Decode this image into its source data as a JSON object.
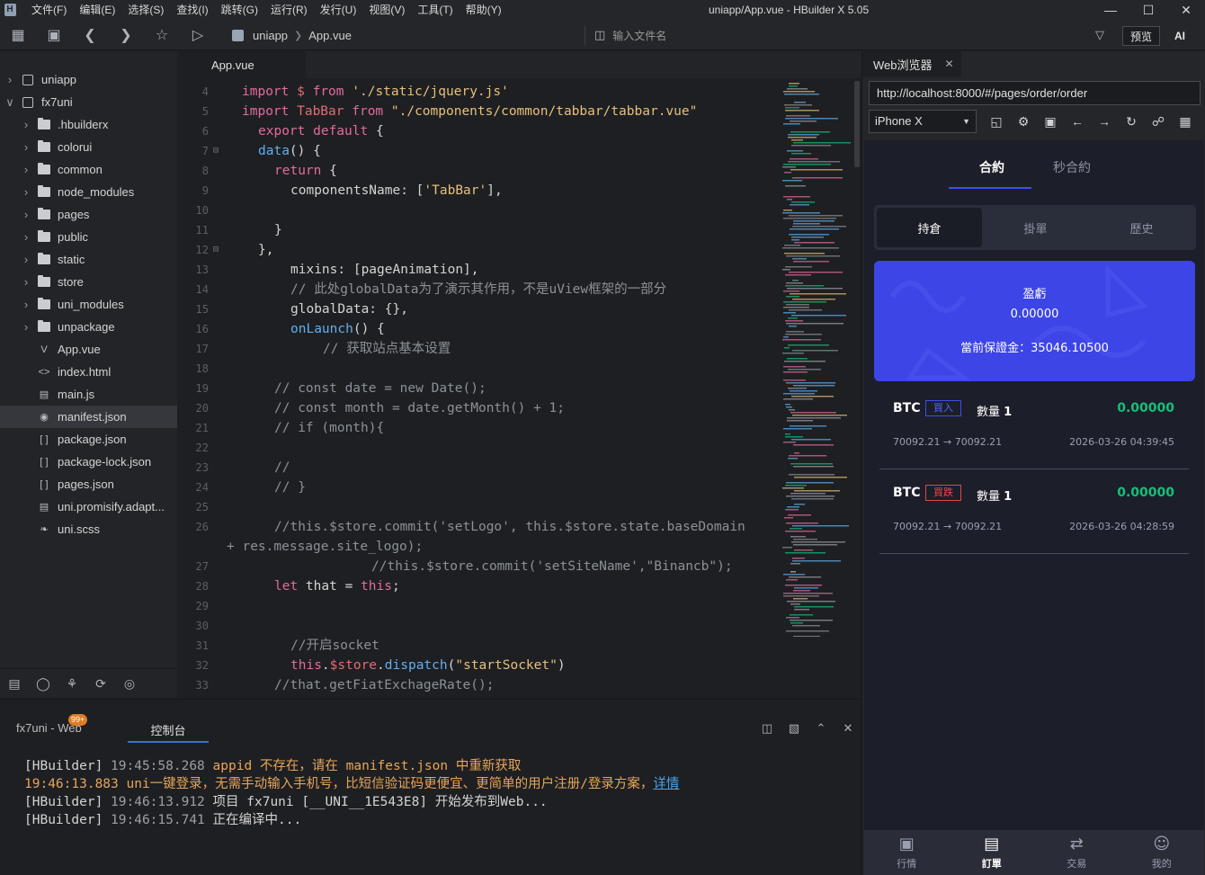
{
  "app": {
    "window_title": "uniapp/App.vue - HBuilder X 5.05",
    "menu": [
      "文件(F)",
      "编辑(E)",
      "选择(S)",
      "查找(I)",
      "跳转(G)",
      "运行(R)",
      "发行(U)",
      "视图(V)",
      "工具(T)",
      "帮助(Y)"
    ]
  },
  "toolbar": {
    "breadcrumb_root": "uniapp",
    "breadcrumb_file": "App.vue",
    "file_search_placeholder": "输入文件名",
    "preview_label": "预览",
    "ai_label": "AI"
  },
  "sidebar": {
    "items": [
      {
        "label": "uniapp",
        "type": "project",
        "level": 0,
        "expanded": false
      },
      {
        "label": "fx7uni",
        "type": "project",
        "level": 0,
        "expanded": true
      },
      {
        "label": ".hbuilderx",
        "type": "folder",
        "level": 1
      },
      {
        "label": "colorui",
        "type": "folder",
        "level": 1
      },
      {
        "label": "common",
        "type": "folder",
        "level": 1
      },
      {
        "label": "node_modules",
        "type": "folder",
        "level": 1
      },
      {
        "label": "pages",
        "type": "folder",
        "level": 1
      },
      {
        "label": "public",
        "type": "folder",
        "level": 1
      },
      {
        "label": "static",
        "type": "folder",
        "level": 1
      },
      {
        "label": "store",
        "type": "folder",
        "level": 1
      },
      {
        "label": "uni_modules",
        "type": "folder",
        "level": 1
      },
      {
        "label": "unpackage",
        "type": "folder",
        "level": 1
      },
      {
        "label": "App.vue",
        "type": "vue",
        "level": 1
      },
      {
        "label": "index.html",
        "type": "html",
        "level": 1
      },
      {
        "label": "main.js",
        "type": "js",
        "level": 1
      },
      {
        "label": "manifest.json",
        "type": "manifest",
        "level": 1,
        "selected": true
      },
      {
        "label": "package.json",
        "type": "json",
        "level": 1
      },
      {
        "label": "package-lock.json",
        "type": "json",
        "level": 1
      },
      {
        "label": "pages.json",
        "type": "json",
        "level": 1
      },
      {
        "label": "uni.promisify.adapt...",
        "type": "js",
        "level": 1
      },
      {
        "label": "uni.scss",
        "type": "scss",
        "level": 1
      }
    ]
  },
  "editor": {
    "tab_label": "App.vue",
    "lines": [
      {
        "n": "4",
        "code": [
          [
            "import",
            "kw"
          ],
          [
            " ",
            ""
          ],
          [
            "$",
            "var"
          ],
          [
            " from ",
            "kw"
          ],
          [
            "'./static/jquery.js'",
            "str"
          ]
        ],
        "indent": 0
      },
      {
        "n": "5",
        "code": [
          [
            "import",
            "kw"
          ],
          [
            " TabBar ",
            "var"
          ],
          [
            "from",
            "kw"
          ],
          [
            " \"./components/common/tabbar/tabbar.vue\"",
            "str"
          ]
        ],
        "indent": 0
      },
      {
        "n": "6",
        "code": [
          [
            "export default",
            "kw"
          ],
          [
            " {",
            ""
          ]
        ],
        "indent": 1
      },
      {
        "n": "7",
        "code": [
          [
            "data",
            "fn"
          ],
          [
            "() {",
            ""
          ]
        ],
        "indent": 1,
        "fold": true
      },
      {
        "n": "8",
        "code": [
          [
            "return",
            "kw"
          ],
          [
            " {",
            ""
          ]
        ],
        "indent": 2
      },
      {
        "n": "9",
        "code": [
          [
            "componentsName: [",
            ""
          ],
          [
            "'TabBar'",
            "str"
          ],
          [
            "],",
            ""
          ]
        ],
        "indent": 3
      },
      {
        "n": "10",
        "code": [],
        "indent": 0
      },
      {
        "n": "11",
        "code": [
          [
            "}",
            ""
          ]
        ],
        "indent": 2
      },
      {
        "n": "12",
        "code": [
          [
            "},",
            ""
          ]
        ],
        "indent": 1,
        "fold": true
      },
      {
        "n": "13",
        "code": [
          [
            "mixins: [pageAnimation],",
            ""
          ]
        ],
        "indent": 3
      },
      {
        "n": "14",
        "code": [
          [
            "// 此处globalData为了演示其作用，不是uView框架的一部分",
            "cm"
          ]
        ],
        "indent": 3
      },
      {
        "n": "15",
        "code": [
          [
            "globalData: {},",
            ""
          ]
        ],
        "indent": 3
      },
      {
        "n": "16",
        "code": [
          [
            "onLaunch",
            "fn"
          ],
          [
            "() {",
            ""
          ]
        ],
        "indent": 3
      },
      {
        "n": "17",
        "code": [
          [
            "// 获取站点基本设置",
            "cm"
          ]
        ],
        "indent": 5
      },
      {
        "n": "18",
        "code": [],
        "indent": 0
      },
      {
        "n": "19",
        "code": [
          [
            "// const date = new Date();",
            "cm"
          ]
        ],
        "indent": 2
      },
      {
        "n": "20",
        "code": [
          [
            "// const month = date.getMonth() + 1;",
            "cm"
          ]
        ],
        "indent": 2
      },
      {
        "n": "21",
        "code": [
          [
            "// if (month){",
            "cm"
          ]
        ],
        "indent": 2
      },
      {
        "n": "22",
        "code": [],
        "indent": 0
      },
      {
        "n": "23",
        "code": [
          [
            "//",
            "cm"
          ]
        ],
        "indent": 2
      },
      {
        "n": "24",
        "code": [
          [
            "// }",
            "cm"
          ]
        ],
        "indent": 2
      },
      {
        "n": "25",
        "code": [],
        "indent": 0
      },
      {
        "n": "26",
        "code": [
          [
            "//this.$store.commit('setLogo', this.$store.state.baseDomain",
            "cm"
          ]
        ],
        "indent": 2
      },
      {
        "n": "",
        "code": [
          [
            "+ res.message.site_logo);",
            "cm"
          ]
        ],
        "indent": -1
      },
      {
        "n": "27",
        "code": [
          [
            "//this.$store.commit('setSiteName',\"Binancb\");",
            "cm"
          ]
        ],
        "indent": 8
      },
      {
        "n": "28",
        "code": [
          [
            "let",
            "kw"
          ],
          [
            " that = ",
            ""
          ],
          [
            "this",
            "kw"
          ],
          [
            ";",
            ""
          ]
        ],
        "indent": 2
      },
      {
        "n": "29",
        "code": [],
        "indent": 0
      },
      {
        "n": "30",
        "code": [],
        "indent": 0
      },
      {
        "n": "31",
        "code": [
          [
            "//开启socket",
            "cm"
          ]
        ],
        "indent": 3
      },
      {
        "n": "32",
        "code": [
          [
            "this",
            "kw"
          ],
          [
            ".",
            ""
          ],
          [
            "$store",
            "var"
          ],
          [
            ".",
            ""
          ],
          [
            "dispatch",
            "fn"
          ],
          [
            "(",
            ""
          ],
          [
            "\"startSocket\"",
            "str"
          ],
          [
            ")",
            ""
          ]
        ],
        "indent": 3
      },
      {
        "n": "33",
        "code": [
          [
            "//that.getFiatExchageRate();",
            "cm"
          ]
        ],
        "indent": 2
      }
    ]
  },
  "console": {
    "tab_web": "fx7uni - Web",
    "badge": "99+",
    "tab_console": "控制台",
    "lines": [
      [
        [
          "[HBuilder] ",
          ""
        ],
        [
          "19:45:58.268 ",
          "dim"
        ],
        [
          "appid 不存在，请在 manifest.json 中重新获取",
          "orange"
        ]
      ],
      [
        [
          "19:46:13.883 uni一键登录，无需手动输入手机号，比短信验证码更便宜、更简单的用户注册/登录方案，",
          "orange"
        ],
        [
          "详情",
          "link"
        ]
      ],
      [
        [
          "[HBuilder] ",
          ""
        ],
        [
          "19:46:13.912 ",
          "dim"
        ],
        [
          "项目 fx7uni [__UNI__1E543E8] 开始发布到Web...",
          ""
        ]
      ],
      [
        [
          "[HBuilder] ",
          ""
        ],
        [
          "19:46:15.741 ",
          "dim"
        ],
        [
          "正在编译中...",
          ""
        ]
      ]
    ]
  },
  "browser": {
    "tab_label": "Web浏览器",
    "url": "http://localhost:8000/#/pages/order/order",
    "device": "iPhone X"
  },
  "mobile": {
    "top_tabs": [
      "合約",
      "秒合約"
    ],
    "segments": [
      "持倉",
      "掛單",
      "歷史"
    ],
    "pnl_label": "盈虧",
    "pnl_value": "0.00000",
    "margin_text": "當前保證金：35046.10500",
    "orders": [
      {
        "symbol": "BTC",
        "side": "買入",
        "side_type": "buy",
        "qty_label": "數量",
        "qty": "1",
        "pnl": "0.00000",
        "prices": "70092.21 → 70092.21",
        "time": "2026-03-26 04:39:45"
      },
      {
        "symbol": "BTC",
        "side": "買跌",
        "side_type": "sell",
        "qty_label": "數量",
        "qty": "1",
        "pnl": "0.00000",
        "prices": "70092.21 → 70092.21",
        "time": "2026-03-26 04:28:59"
      }
    ],
    "bottom_nav": [
      "行情",
      "訂單",
      "交易",
      "我的"
    ]
  },
  "colors": {
    "accent_blue": "#3d45e6",
    "profit_green": "#14c07a",
    "sell_red": "#ef4a4a"
  }
}
